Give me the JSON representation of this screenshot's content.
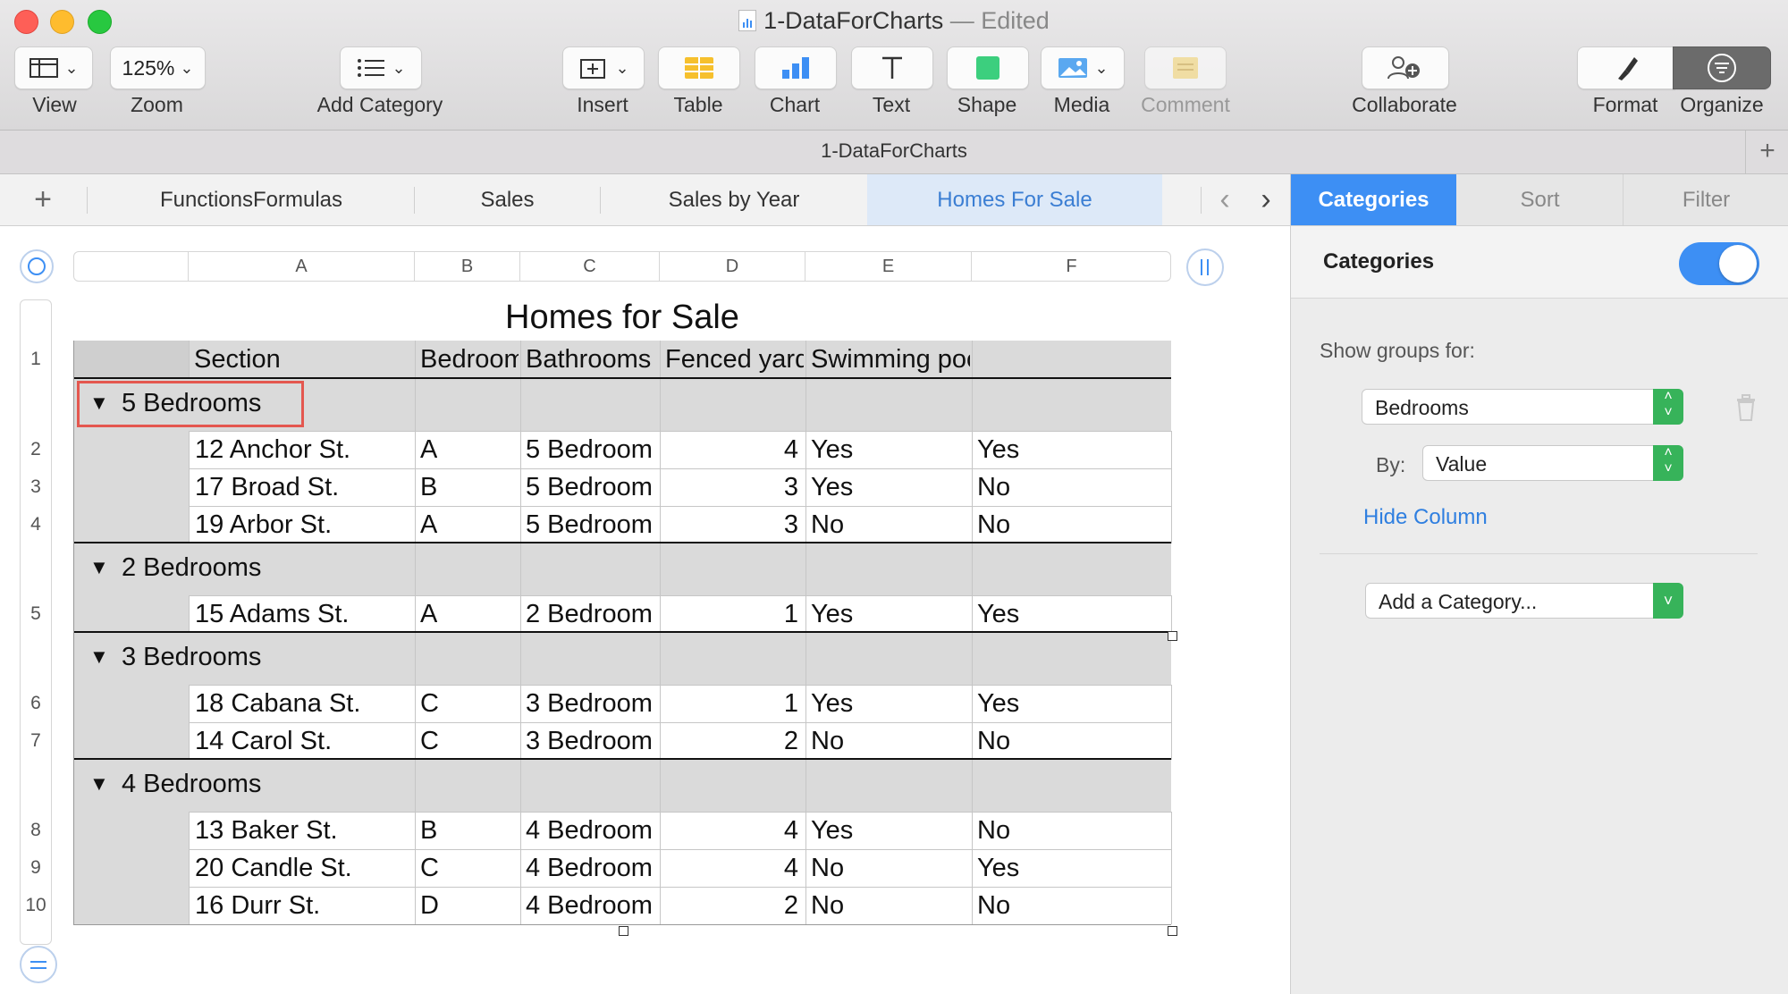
{
  "window": {
    "file_name": "1-DataForCharts",
    "edited_label": "— Edited"
  },
  "toolbar": {
    "view_label": "View",
    "zoom_value": "125%",
    "zoom_label": "Zoom",
    "add_category_label": "Add Category",
    "insert_label": "Insert",
    "table_label": "Table",
    "chart_label": "Chart",
    "text_label": "Text",
    "shape_label": "Shape",
    "media_label": "Media",
    "comment_label": "Comment",
    "collaborate_label": "Collaborate",
    "format_label": "Format",
    "organize_label": "Organize"
  },
  "document_bar": {
    "name": "1-DataForCharts"
  },
  "sheet_tabs": {
    "tabs": [
      {
        "label": "FunctionsFormulas"
      },
      {
        "label": "Sales"
      },
      {
        "label": "Sales by Year"
      },
      {
        "label": "Homes For Sale"
      }
    ],
    "active_tab": "Homes For Sale"
  },
  "table": {
    "title": "Homes for Sale",
    "column_letters": [
      "A",
      "B",
      "C",
      "D",
      "E",
      "F"
    ],
    "headers": [
      "",
      "Section",
      "Bedrooms",
      "Bathrooms",
      "Fenced yard",
      "Swimming pool"
    ],
    "groups": [
      {
        "label": "5 Bedrooms",
        "rows": [
          {
            "num": "2",
            "address": "12 Anchor St.",
            "section": "A",
            "bedrooms": "5 Bedroom",
            "bathrooms": "4",
            "fenced": "Yes",
            "pool": "Yes"
          },
          {
            "num": "3",
            "address": "17 Broad St.",
            "section": "B",
            "bedrooms": "5 Bedroom",
            "bathrooms": "3",
            "fenced": "Yes",
            "pool": "No"
          },
          {
            "num": "4",
            "address": "19 Arbor St.",
            "section": "A",
            "bedrooms": "5 Bedroom",
            "bathrooms": "3",
            "fenced": "No",
            "pool": "No"
          }
        ]
      },
      {
        "label": "2 Bedrooms",
        "rows": [
          {
            "num": "5",
            "address": "15 Adams St.",
            "section": "A",
            "bedrooms": "2 Bedroom",
            "bathrooms": "1",
            "fenced": "Yes",
            "pool": "Yes"
          }
        ]
      },
      {
        "label": "3 Bedrooms",
        "rows": [
          {
            "num": "6",
            "address": "18 Cabana St.",
            "section": "C",
            "bedrooms": "3 Bedroom",
            "bathrooms": "1",
            "fenced": "Yes",
            "pool": "Yes"
          },
          {
            "num": "7",
            "address": "14 Carol St.",
            "section": "C",
            "bedrooms": "3 Bedroom",
            "bathrooms": "2",
            "fenced": "No",
            "pool": "No"
          }
        ]
      },
      {
        "label": "4 Bedrooms",
        "rows": [
          {
            "num": "8",
            "address": "13 Baker St.",
            "section": "B",
            "bedrooms": "4 Bedroom",
            "bathrooms": "4",
            "fenced": "Yes",
            "pool": "No"
          },
          {
            "num": "9",
            "address": "20 Candle St.",
            "section": "C",
            "bedrooms": "4 Bedroom",
            "bathrooms": "4",
            "fenced": "No",
            "pool": "Yes"
          },
          {
            "num": "10",
            "address": "16 Durr St.",
            "section": "D",
            "bedrooms": "4 Bedroom",
            "bathrooms": "2",
            "fenced": "No",
            "pool": "No"
          }
        ]
      }
    ],
    "header_row_num": "1"
  },
  "panel": {
    "tabs": [
      "Categories",
      "Sort",
      "Filter"
    ],
    "active_tab": "Categories",
    "categories_heading": "Categories",
    "categories_enabled": true,
    "show_groups_label": "Show groups for:",
    "group_by_value": "Bedrooms",
    "by_label": "By:",
    "by_value": "Value",
    "hide_column_link": "Hide Column",
    "add_category_value": "Add a Category..."
  },
  "colors": {
    "accent_blue": "#3d8ff4",
    "active_sheet_tab_bg": "#dde9f8",
    "active_sheet_tab_text": "#3b7ed3",
    "group_row_bg": "#dadada",
    "highlight_box": "#e4574f",
    "stepper_green": "#37b35a"
  }
}
